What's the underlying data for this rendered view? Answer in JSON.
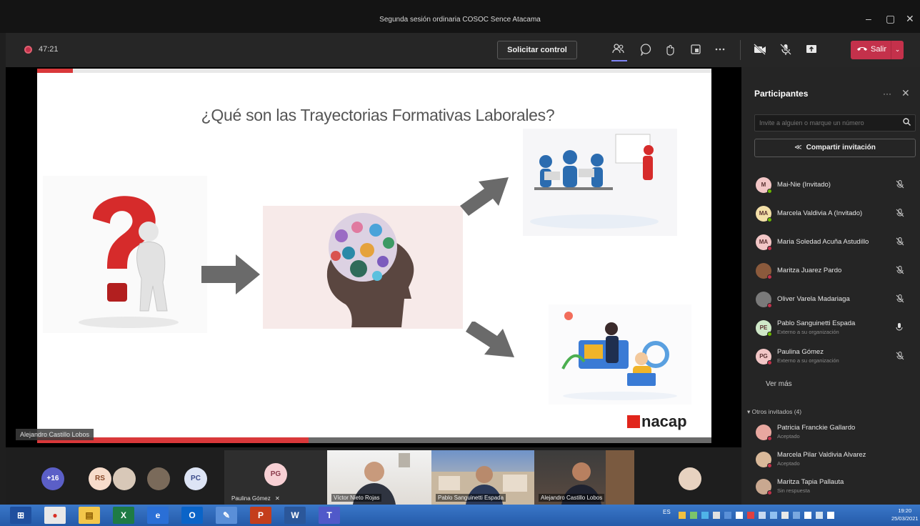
{
  "window": {
    "title": "Segunda sesión ordinaria COSOC Sence Atacama",
    "controls": {
      "minimize": "–",
      "maximize": "▢",
      "close": "✕"
    }
  },
  "toolbar": {
    "recording_time": "47:21",
    "request_control_label": "Solicitar control",
    "leave_label": "Salir",
    "icons": [
      "participants-icon",
      "chat-icon",
      "reactions-icon",
      "rooms-icon",
      "more-icon",
      "camera-off-icon",
      "mic-off-icon",
      "share-icon"
    ]
  },
  "slide": {
    "title": "¿Qué son las Trayectorias Formativas Laborales?",
    "logo_text": "nacap",
    "presenter_label": "Alejandro Castillo Lobos"
  },
  "panel": {
    "title": "Participantes",
    "invite_placeholder": "Invite a alguien o marque un número",
    "share_label": "Compartir invitación",
    "see_more": "Ver más",
    "others_header": "Otros invitados (4)",
    "participants": [
      {
        "initials": "M",
        "name": "Mai-Nie (Invitado)",
        "sub": "",
        "avatar_color": "#f2c6c6",
        "status": "#6bb700"
      },
      {
        "initials": "MA",
        "name": "Marcela Valdivia A (Invitado)",
        "sub": "",
        "avatar_color": "#f3dfa8",
        "status": "#6bb700"
      },
      {
        "initials": "MA",
        "name": "Maria Soledad Acuña Astudillo",
        "sub": "",
        "avatar_color": "#f2c6c6",
        "status": "#c4314b"
      },
      {
        "initials": "",
        "name": "Maritza Juarez Pardo",
        "sub": "",
        "avatar_color": "#8b5a3c",
        "status": "#c4314b"
      },
      {
        "initials": "",
        "name": "Oliver Varela Madariaga",
        "sub": "",
        "avatar_color": "#7a7a7a",
        "status": "#c4314b"
      },
      {
        "initials": "PE",
        "name": "Pablo Sanguinetti Espada",
        "sub": "Externo a su organización",
        "avatar_color": "#cfe8c8",
        "status": "#6bb700"
      },
      {
        "initials": "PG",
        "name": "Paulina Gómez",
        "sub": "Externo a su organización",
        "avatar_color": "#f2c6c6",
        "status": "#c4314b"
      }
    ],
    "others": [
      {
        "name": "Patricia Franckie Gallardo",
        "sub": "Aceptado",
        "avatar_color": "#e8a8a0"
      },
      {
        "name": "Marcela Pilar Valdivia Alvarez",
        "sub": "Aceptado",
        "avatar_color": "#d9b99a"
      },
      {
        "name": "Maritza Tapia Pallauta",
        "sub": "Sin respuesta",
        "avatar_color": "#c9a890"
      }
    ]
  },
  "gallery": {
    "avatars": [
      {
        "text": "+16",
        "bg": "#5b5fc7",
        "fg": "#ffffff"
      },
      {
        "text": "RS",
        "bg": "#f7dccb",
        "fg": "#8a4a2a"
      },
      {
        "text": "",
        "bg": "#d8c8b8",
        "fg": "#333333"
      },
      {
        "text": "",
        "bg": "#7a6a5a",
        "fg": "#ffffff"
      },
      {
        "text": "PC",
        "bg": "#dde4f5",
        "fg": "#3a4a8a"
      }
    ],
    "active": {
      "text": "PG",
      "label": "Paulina Gómez"
    },
    "tiles": [
      {
        "label": "Víctor Nieto Rojas"
      },
      {
        "label": "Pablo Sanguinetti Espada"
      },
      {
        "label": "Alejandro Castillo Lobos"
      }
    ]
  },
  "taskbar": {
    "language": "ES",
    "time": "19:20",
    "date": "25/03/2021",
    "apps": [
      "start-icon",
      "chrome-icon",
      "explorer-icon",
      "excel-icon",
      "ie-icon",
      "outlook-icon",
      "paint-icon",
      "powerpoint-icon",
      "word-icon",
      "teams-icon"
    ]
  }
}
